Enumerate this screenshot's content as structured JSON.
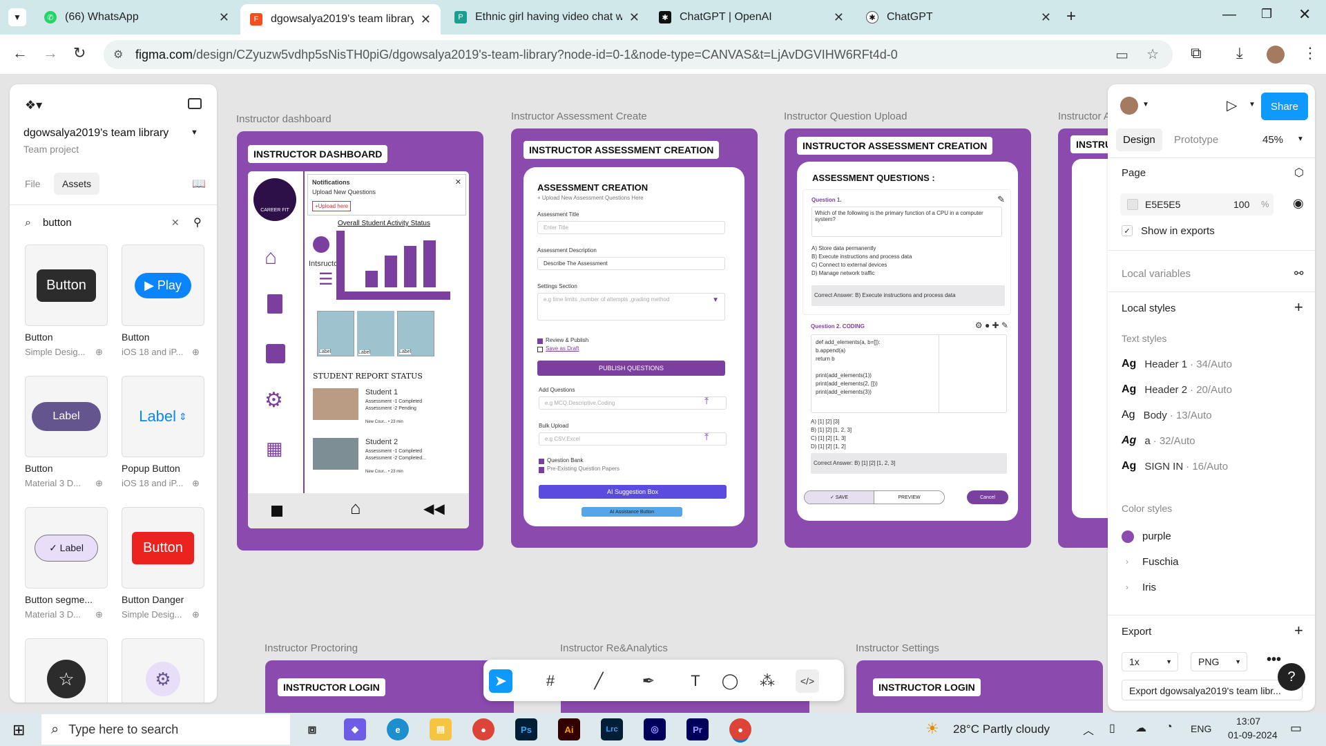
{
  "browser": {
    "tabs": [
      {
        "title": "(66) WhatsApp",
        "icon": "whatsapp-icon",
        "color": "#25d366"
      },
      {
        "title": "dgowsalya2019's team library – ",
        "icon": "figma-icon",
        "color": "#f24e1e",
        "active": true
      },
      {
        "title": "Ethnic girl having video chat wi",
        "icon": "freepik-icon",
        "color": "#1a9e8f"
      },
      {
        "title": "ChatGPT | OpenAI",
        "icon": "openai-icon",
        "color": "#111111"
      },
      {
        "title": "ChatGPT",
        "icon": "openai-icon",
        "color": "#111111"
      }
    ],
    "url_domain": "figma.com",
    "url_path": "/design/CZyuzw5vdhp5sNisTH0piG/dgowsalya2019's-team-library?node-id=0-1&node-type=CANVAS&t=LjAvDGVIHW6RFt4d-0"
  },
  "left": {
    "team": "dgowsalya2019's team library",
    "project": "Team project",
    "tab_file": "File",
    "tab_assets": "Assets",
    "search_value": "button",
    "assets": [
      {
        "preview": "Button",
        "name": "Button",
        "sub": "Simple Desig..."
      },
      {
        "preview": "▶ Play",
        "name": "Button",
        "sub": "iOS 18 and iP..."
      },
      {
        "preview": "Label",
        "name": "Button",
        "sub": "Material 3 D..."
      },
      {
        "preview": "Label",
        "name": "Popup Button",
        "sub": "iOS 18 and iP..."
      },
      {
        "preview": "✓ Label",
        "name": "Button segme...",
        "sub": "Material 3 D..."
      },
      {
        "preview": "Button",
        "name": "Button Danger",
        "sub": "Simple Desig..."
      }
    ]
  },
  "canvas": {
    "frame_labels": [
      "Instructor dashboard",
      "Instructor Assessment  Create",
      "Instructor Question  Upload",
      "Instructor A",
      "Instructor Proctoring",
      "Instructor Re&Analytics",
      "Instructor Settings"
    ],
    "dashboard": {
      "title": "INSTRUCTOR DASHBOARD",
      "logo": "CAREER FIT",
      "notif_title": "Notifications",
      "notif_text": "Upload New Questions",
      "upload": "+Upload here",
      "activity": "Overall Student  Activity Status",
      "role": "Intsructor",
      "labels": [
        "Label",
        "Label",
        "Label"
      ],
      "report": "STUDENT REPORT STATUS",
      "students": [
        {
          "name": "Student 1",
          "l1": "Assessment -1 Completed",
          "l2": "Assessment -2 Pending",
          "meta": "New Cour... • 23 min"
        },
        {
          "name": "Student 2",
          "l1": "Assessment -1 Completed",
          "l2": "Assessment -2 Completed...",
          "meta": "New Cour... • 23 min"
        }
      ]
    },
    "create": {
      "title": "INSTRUCTOR ASSESSMENT CREATION",
      "heading": "ASSESSMENT  CREATION",
      "sub": "+ Upload New Assessment Questions Here",
      "l_title": "Assessment Title",
      "p_title": "Enter Title",
      "l_desc": "Assessment Description",
      "v_desc": "Describe The Assessment",
      "l_settings": "Settings Section",
      "p_settings": "e.g time limits ,number of attempts ,grading method",
      "review": "Review & Publish",
      "draft": "Save as Draft",
      "publish": "PUBLISH QUESTIONS",
      "l_add": "Add Questions",
      "p_add": "e.g MCQ,Descriptive,Coding",
      "l_bulk": "Bulk Upload",
      "p_bulk": "e.g CSV,Excel",
      "bank": "Question Bank",
      "papers": "Pre-Existing  Question Papers",
      "ai": "AI Suggestion Box",
      "ai2": "AI Assistance Button"
    },
    "upload": {
      "title": "INSTRUCTOR ASSESSMENT CREATION",
      "heading": "ASSESSMENT QUESTIONS :",
      "q1": "Question 1.",
      "q1_text": "Which of the following is the primary function of a CPU in a computer system?",
      "q1_opts": [
        "A) Store data permanently",
        "B) Execute instructions and process data",
        "C) Connect to external devices",
        "D) Manage network traffic"
      ],
      "q1_ans": "Correct Answer: B) Execute instructions and process data",
      "q2": "Question 2.   CODING",
      "code": [
        "def add_elements(a, b=[]):",
        "   b.append(a)",
        "   return b",
        "",
        "print(add_elements(1))",
        "print(add_elements(2, []))",
        "print(add_elements(3))"
      ],
      "q2_opts": [
        "A) [1] [2] [3]",
        "B) [1] [2] [1, 2, 3]",
        "C) [1] [2] [1, 3]",
        "D) [1] [2] [1, 2]"
      ],
      "q2_ans": "Correct Answer:  B) [1] [2] [1, 2, 3]",
      "save": "✓  SAVE",
      "preview": "PREVIEW",
      "cancel": "Cancel"
    },
    "fourth_title": "INSTRU",
    "login_title": "INSTRUCTOR LOGIN"
  },
  "right": {
    "tab_design": "Design",
    "tab_prototype": "Prototype",
    "zoom": "45%",
    "share": "Share",
    "page_label": "Page",
    "page_color": "E5E5E5",
    "page_opacity": "100",
    "pct": "%",
    "show_exports": "Show in exports",
    "local_vars": "Local variables",
    "local_styles": "Local styles",
    "text_styles_label": "Text styles",
    "text_styles": [
      {
        "name": "Header 1",
        "meta": "· 34/Auto"
      },
      {
        "name": "Header 2",
        "meta": "· 20/Auto"
      },
      {
        "name": "Body",
        "meta": "· 13/Auto"
      },
      {
        "name": "a",
        "meta": "· 32/Auto"
      },
      {
        "name": "SIGN IN",
        "meta": "· 16/Auto"
      }
    ],
    "color_styles_label": "Color styles",
    "color_styles": [
      "purple",
      "Fuschia",
      "Iris"
    ],
    "export_label": "Export",
    "export_scale": "1x",
    "export_format": "PNG",
    "export_btn": "Export dgowsalya2019's team libr..."
  },
  "taskbar": {
    "search": "Type here to search",
    "weather": "28°C  Partly cloudy",
    "lang": "ENG",
    "time": "13:07",
    "date": "01-09-2024"
  },
  "colors": {
    "accent": "#0d99ff",
    "frame": "#8a4aae",
    "purple": "#7b3fa0"
  }
}
